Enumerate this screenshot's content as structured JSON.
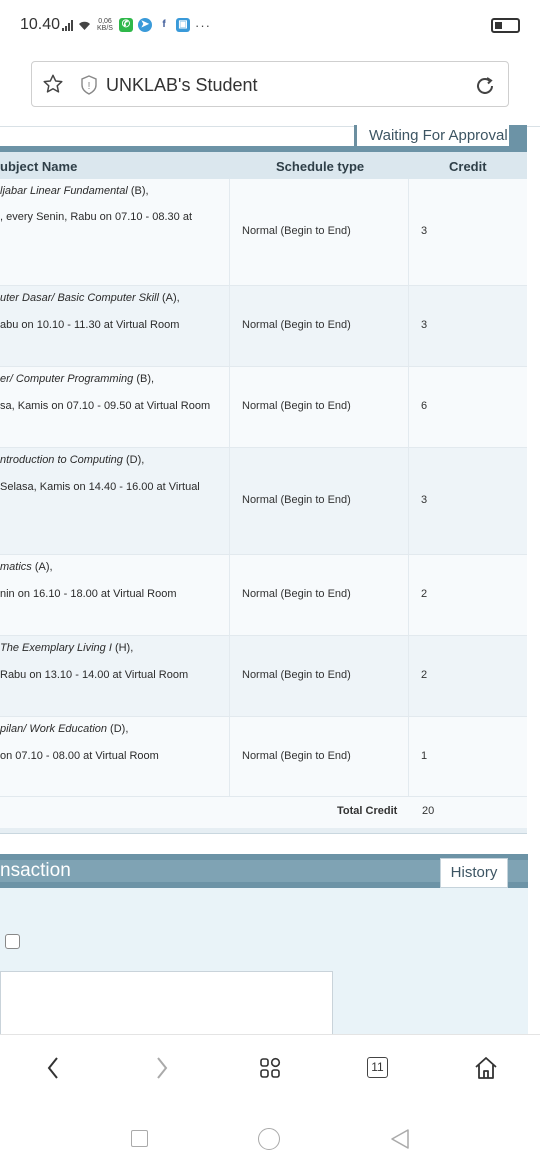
{
  "status_bar": {
    "time": "10.40",
    "net_speed_top": "0,06",
    "net_speed_bottom": "KB/S",
    "more": "···",
    "icons": [
      "signal-icon",
      "wifi-icon",
      "whatsapp-icon",
      "telegram-icon",
      "facebook-icon",
      "app-icon",
      "battery-icon"
    ]
  },
  "browser": {
    "page_title": "UNKLAB's Student",
    "tab_count": "11"
  },
  "schedule": {
    "status_tab": "Waiting For Approval",
    "columns": {
      "subject": "ubject Name",
      "schedule_type": "Schedule type",
      "credit": "Credit"
    },
    "rows": [
      {
        "name": "ljabar Linear Fundamental",
        "section": " (B),",
        "time": ", every Senin, Rabu on 07.10 - 08.30 at",
        "schedule_type": "Normal (Begin to End)",
        "credit": "3"
      },
      {
        "name": "uter Dasar/ Basic Computer Skill",
        "section": " (A),",
        "time": "abu on 10.10 - 11.30 at Virtual Room",
        "schedule_type": "Normal (Begin to End)",
        "credit": "3"
      },
      {
        "name": "er/ Computer Programming",
        "section": " (B),",
        "time": "sa, Kamis on 07.10 - 09.50 at Virtual Room",
        "schedule_type": "Normal (Begin to End)",
        "credit": "6"
      },
      {
        "name": "ntroduction to Computing",
        "section": " (D),",
        "time": " Selasa, Kamis on 14.40 - 16.00 at Virtual",
        "schedule_type": "Normal (Begin to End)",
        "credit": "3"
      },
      {
        "name": "matics",
        "section": " (A),",
        "time": "nin on 16.10 - 18.00 at Virtual Room",
        "schedule_type": "Normal (Begin to End)",
        "credit": "2"
      },
      {
        "name": " The Exemplary Living I",
        "section": " (H),",
        "time": "Rabu on 13.10 - 14.00 at Virtual Room",
        "schedule_type": "Normal (Begin to End)",
        "credit": "2"
      },
      {
        "name": "pilan/ Work Education",
        "section": " (D),",
        "time": "on 07.10 - 08.00 at Virtual Room",
        "schedule_type": "Normal (Begin to End)",
        "credit": "1"
      }
    ],
    "total_label": "Total Credit",
    "total_value": "20"
  },
  "transaction": {
    "title": "nsaction",
    "history_button": "History"
  },
  "colors": {
    "header_bar": "#6c93a6",
    "table_head_bg": "#dbe7ee",
    "panel_bg": "#e9f3f8"
  }
}
